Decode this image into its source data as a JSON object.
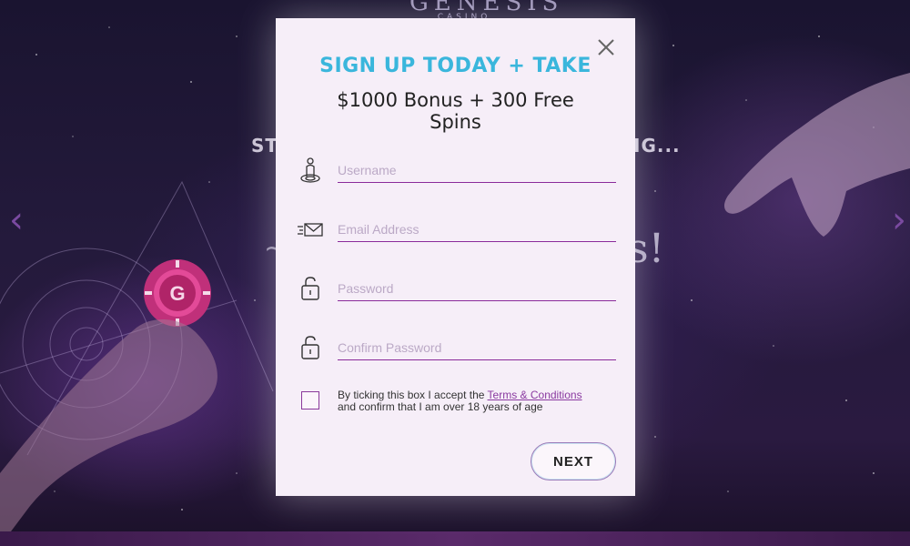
{
  "brand": {
    "name": "GENESIS",
    "sub": "CASINO"
  },
  "background": {
    "heading_left": "ST",
    "heading_right": "IG...",
    "script_right": "s!",
    "script_left": "~"
  },
  "nav": {
    "prev_arrow": "‹",
    "next_arrow": "›"
  },
  "modal": {
    "headline": "SIGN UP TODAY + TAKE",
    "subheadline": "$1000 Bonus + 300 Free Spins",
    "fields": {
      "username": {
        "placeholder": "Username",
        "icon": "user-icon"
      },
      "email": {
        "placeholder": "Email Address",
        "icon": "mail-icon"
      },
      "password": {
        "placeholder": "Password",
        "icon": "lock-icon"
      },
      "confirm_password": {
        "placeholder": "Confirm Password",
        "icon": "lock-icon"
      }
    },
    "terms": {
      "prefix": "By ticking this box I accept the ",
      "link": "Terms & Conditions",
      "suffix": " and confirm that I am over 18 years of age"
    },
    "next_label": "NEXT"
  },
  "colors": {
    "accent_blue": "#3ab6dc",
    "accent_purple": "#8a2a9a",
    "modal_bg": "#f6eef8"
  }
}
